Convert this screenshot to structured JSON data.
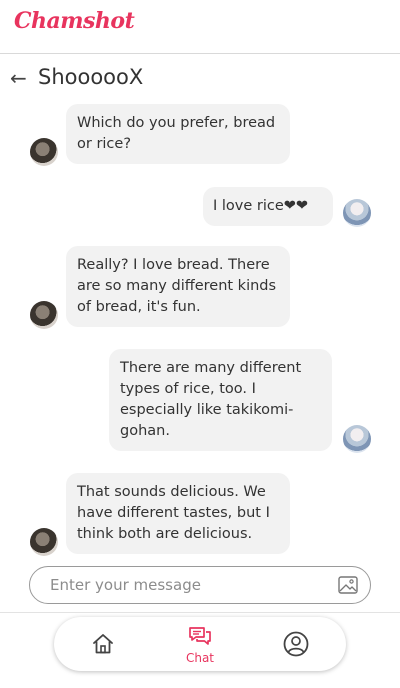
{
  "app": {
    "logo": "Chamshot",
    "brand_color": "#e8345e"
  },
  "chat": {
    "title": "ShoooooX"
  },
  "messages": [
    {
      "sender": "other",
      "text": "Which do you prefer, bread or rice?"
    },
    {
      "sender": "me",
      "text": "I love rice❤❤"
    },
    {
      "sender": "other",
      "text": "Really? I love bread. There are so many different kinds of bread, it's fun."
    },
    {
      "sender": "me",
      "text": "There are many different types of rice, too. I especially like takikomi-gohan."
    },
    {
      "sender": "other",
      "text": "That sounds delicious. We have different tastes, but I think both are delicious."
    }
  ],
  "composer": {
    "placeholder": "Enter your message",
    "image_icon": "image-icon"
  },
  "nav": {
    "home_icon": "home-icon",
    "chat_icon": "chat-icon",
    "chat_label": "Chat",
    "profile_icon": "user-icon"
  }
}
